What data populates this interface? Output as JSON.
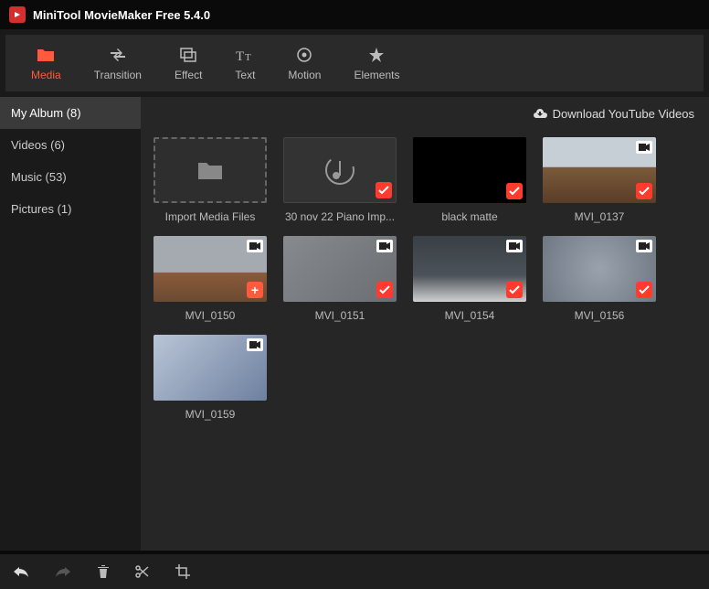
{
  "app": {
    "title": "MiniTool MovieMaker Free 5.4.0"
  },
  "toolbar": [
    {
      "id": "media",
      "label": "Media",
      "active": true
    },
    {
      "id": "transition",
      "label": "Transition"
    },
    {
      "id": "effect",
      "label": "Effect"
    },
    {
      "id": "text",
      "label": "Text"
    },
    {
      "id": "motion",
      "label": "Motion"
    },
    {
      "id": "elements",
      "label": "Elements"
    }
  ],
  "sidebar": [
    {
      "id": "my-album",
      "label": "My Album (8)",
      "active": true
    },
    {
      "id": "videos",
      "label": "Videos (6)"
    },
    {
      "id": "music",
      "label": "Music (53)"
    },
    {
      "id": "pictures",
      "label": "Pictures (1)"
    }
  ],
  "header": {
    "download_label": "Download YouTube Videos"
  },
  "media": [
    {
      "id": "import",
      "label": "Import Media Files",
      "kind": "import"
    },
    {
      "id": "m1",
      "label": "30 nov 22 Piano Imp...",
      "kind": "music",
      "check": true
    },
    {
      "id": "m2",
      "label": "black matte",
      "kind": "black",
      "check": true
    },
    {
      "id": "m3",
      "label": "MVI_0137",
      "kind": "video",
      "thumb": "img1",
      "check": true
    },
    {
      "id": "m4",
      "label": "MVI_0150",
      "kind": "video",
      "thumb": "img2",
      "plus": true
    },
    {
      "id": "m5",
      "label": "MVI_0151",
      "kind": "video",
      "thumb": "img3",
      "check": true
    },
    {
      "id": "m6",
      "label": "MVI_0154",
      "kind": "video",
      "thumb": "img4",
      "check": true
    },
    {
      "id": "m7",
      "label": "MVI_0156",
      "kind": "video",
      "thumb": "img5",
      "check": true
    },
    {
      "id": "m8",
      "label": "MVI_0159",
      "kind": "video",
      "thumb": "img6"
    }
  ],
  "bottombar": {
    "undo": "undo",
    "redo": "redo",
    "delete": "delete",
    "split": "split",
    "crop": "crop"
  }
}
